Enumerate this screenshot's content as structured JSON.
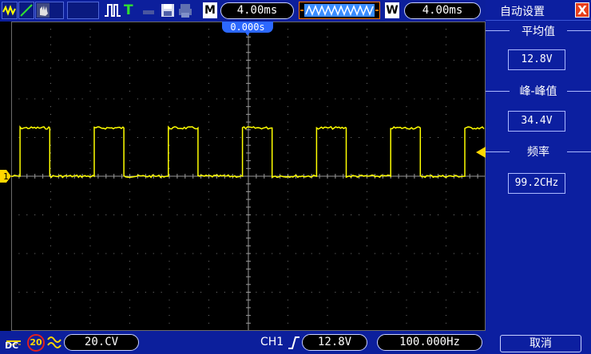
{
  "toolbar": {
    "mode_M": "M",
    "timebase": "4.00ms",
    "mode_W": "W",
    "window_timebase": "4.00ms",
    "trigger_letter": "T",
    "icons": [
      "yellow-zigzag-icon",
      "green-ramp-icon",
      "hand-icon",
      "pulse-icon",
      "trigger-t-icon",
      "save-icon",
      "print-icon"
    ]
  },
  "screen": {
    "trigger_offset": "0.000s",
    "channel_marker": "1",
    "trace_color": "#ffff00",
    "grid_color": "#7a7a7a"
  },
  "signal": {
    "period_divisions": 2.5,
    "high_level_div": 1.6,
    "low_level_div": 0.0,
    "first_rise_div": 0.3,
    "duty": 0.4
  },
  "panel": {
    "title": "自动设置",
    "close": "X",
    "sections": [
      {
        "label": "平均值",
        "value": "12.8V"
      },
      {
        "label": "峰-峰值",
        "value": "34.4V"
      },
      {
        "label": "频率",
        "value": "99.2CHz"
      }
    ],
    "cancel": "取消"
  },
  "status": {
    "coupling": "DC",
    "bw_limit": "20",
    "volts_div": "20.CV",
    "channel": "CH1",
    "trigger_level": "12.8V",
    "frequency": "100.000Hz"
  },
  "colors": {
    "bar_bg": "#0c1f9c",
    "panel_bg": "#0c1fa0",
    "close_bg": "#e8401c",
    "trigger_marker": "#ffd700"
  }
}
